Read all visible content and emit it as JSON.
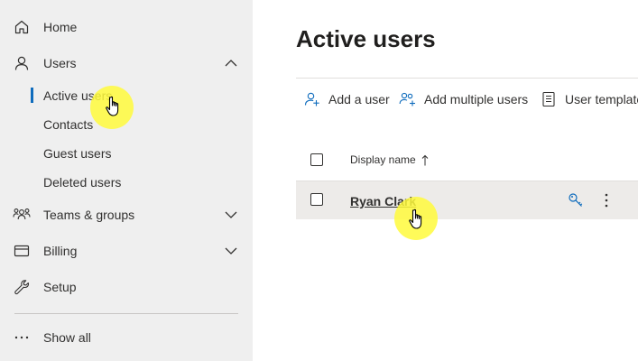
{
  "sidebar": {
    "home_label": "Home",
    "users_label": "Users",
    "users_sub": [
      "Active users",
      "Contacts",
      "Guest users",
      "Deleted users"
    ],
    "teams_label": "Teams & groups",
    "billing_label": "Billing",
    "setup_label": "Setup",
    "show_all_label": "Show all",
    "active_indicator_color": "#0f6cbd"
  },
  "main": {
    "title": "Active users",
    "commands": {
      "add_user": "Add a user",
      "add_multiple": "Add multiple users",
      "user_templates": "User templates"
    },
    "table": {
      "column_display_name": "Display name",
      "rows": [
        {
          "display_name": "Ryan Clark"
        }
      ]
    }
  },
  "icons": {
    "home": "home-icon",
    "users": "person-icon",
    "teams": "people-group-icon",
    "billing": "credit-card-icon",
    "setup": "wrench-icon",
    "show_all": "ellipsis-icon",
    "add_user": "person-add-icon",
    "add_multiple": "people-add-icon",
    "user_templates": "document-list-icon",
    "reset_password": "key-icon",
    "more": "more-vertical-icon",
    "sort": "arrow-up-icon"
  }
}
